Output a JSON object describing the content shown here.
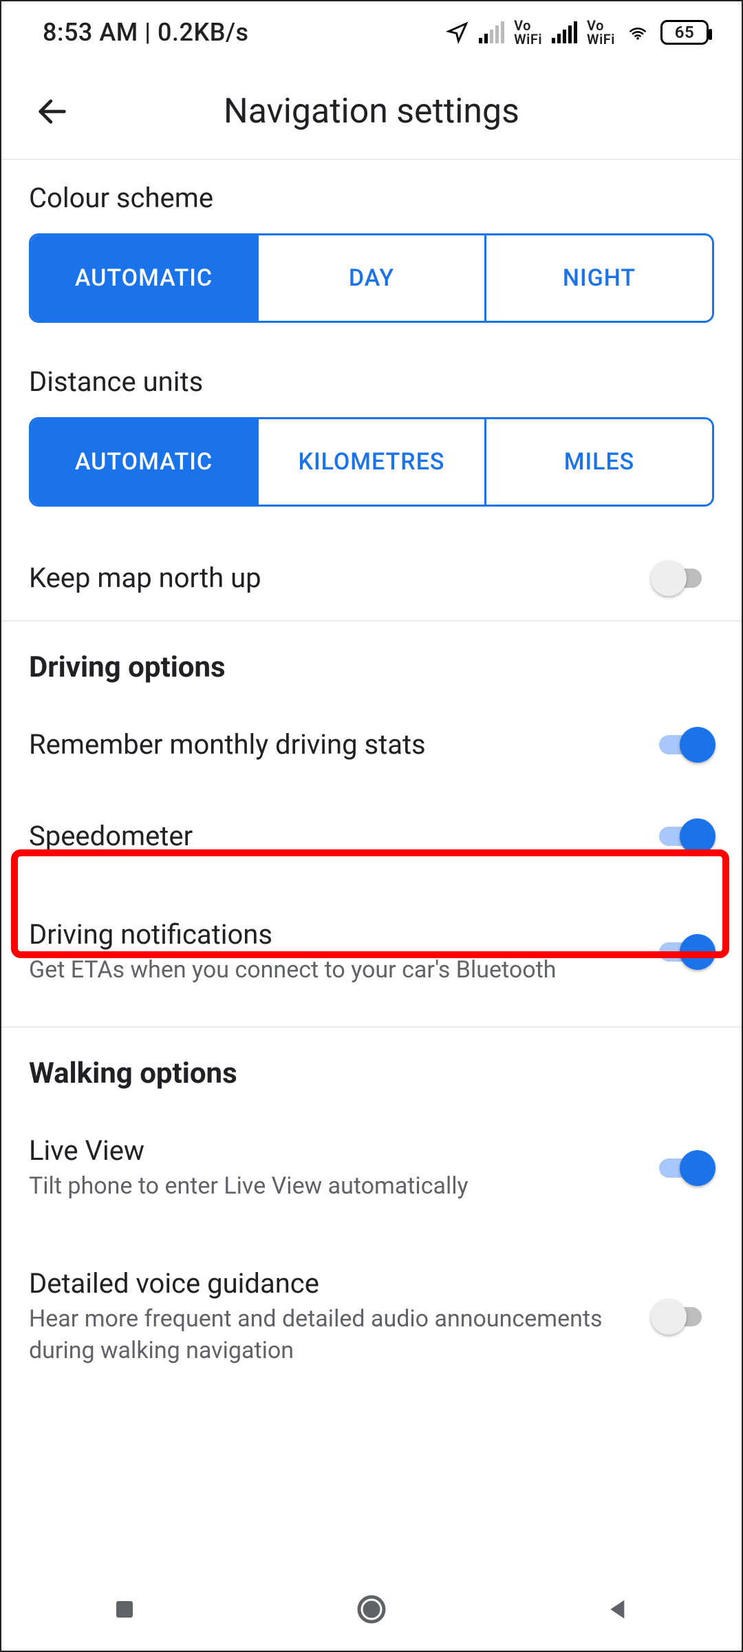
{
  "status": {
    "time": "8:53 AM",
    "net_speed": "0.2KB/s",
    "vo_wifi": "Vo\nWiFi",
    "battery": "65"
  },
  "header": {
    "title": "Navigation settings"
  },
  "colour_scheme": {
    "label": "Colour scheme",
    "options": [
      "AUTOMATIC",
      "DAY",
      "NIGHT"
    ],
    "selected": 0
  },
  "distance_units": {
    "label": "Distance units",
    "options": [
      "AUTOMATIC",
      "KILOMETRES",
      "MILES"
    ],
    "selected": 0
  },
  "keep_north": {
    "title": "Keep map north up",
    "on": false
  },
  "driving": {
    "header": "Driving options",
    "remember": {
      "title": "Remember monthly driving stats",
      "on": true
    },
    "speedometer": {
      "title": "Speedometer",
      "on": true
    },
    "notifications": {
      "title": "Driving notifications",
      "sub": "Get ETAs when you connect to your car's Bluetooth",
      "on": true
    }
  },
  "walking": {
    "header": "Walking options",
    "live_view": {
      "title": "Live View",
      "sub": "Tilt phone to enter Live View automatically",
      "on": true
    },
    "voice": {
      "title": "Detailed voice guidance",
      "sub": "Hear more frequent and detailed audio announcements during walking navigation",
      "on": false
    }
  }
}
